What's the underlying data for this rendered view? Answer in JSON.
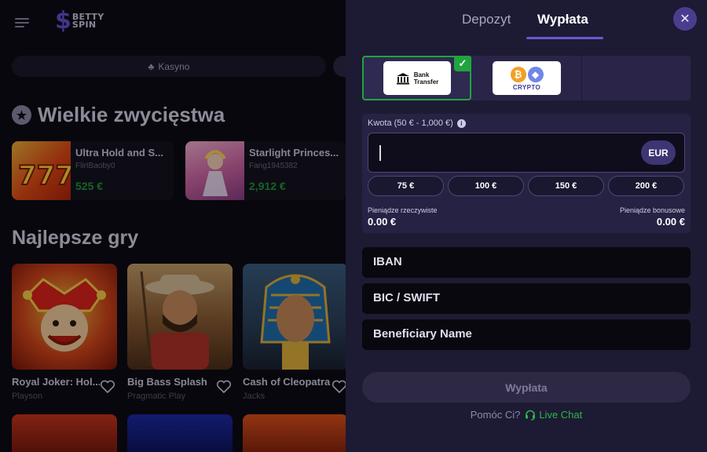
{
  "background": {
    "logo_line1": "BETTY",
    "logo_line2": "SPIN",
    "tab_label": "Kasyno",
    "big_wins_title": "Wielkie zwycięstwa",
    "big_wins": [
      {
        "game": "Ultra Hold and S...",
        "user": "FlirtBaoby0",
        "amount": "525 €"
      },
      {
        "game": "Starlight Princes...",
        "user": "Fang1945382",
        "amount": "2,912 €"
      }
    ],
    "best_games_title": "Najlepsze gry",
    "games": [
      {
        "name": "Royal Joker: Hol...",
        "provider": "Playson"
      },
      {
        "name": "Big Bass Splash",
        "provider": "Pragmatic Play"
      },
      {
        "name": "Cash of Cleopatra",
        "provider": "Jacks"
      }
    ]
  },
  "drawer": {
    "tabs": [
      {
        "label": "Depozyt",
        "active": false
      },
      {
        "label": "Wypłata",
        "active": true
      }
    ],
    "close_icon": "close-icon",
    "methods": {
      "bank_line1": "Bank",
      "bank_line2": "Transfer",
      "crypto_label": "CRYPTO",
      "selected": "bank-transfer"
    },
    "amount": {
      "label": "Kwota (50 € - 1,000 €)",
      "value": "",
      "currency": "EUR",
      "quick_amounts": [
        "75 €",
        "100 €",
        "150 €",
        "200 €"
      ],
      "real_label": "Pieniądze rzeczywiste",
      "real_value": "0.00 €",
      "bonus_label": "Pieniądze bonusowe",
      "bonus_value": "0.00 €"
    },
    "fields": [
      {
        "placeholder": "IBAN"
      },
      {
        "placeholder": "BIC / SWIFT"
      },
      {
        "placeholder": "Beneficiary Name"
      }
    ],
    "submit_label": "Wypłata",
    "help_question": "Pomóc Ci?",
    "live_chat_label": "Live Chat"
  },
  "colors": {
    "accent": "#6b58d6",
    "success": "#21a43d",
    "drawer_bg": "#1d1a33",
    "win_amount": "#1f9a3a"
  }
}
